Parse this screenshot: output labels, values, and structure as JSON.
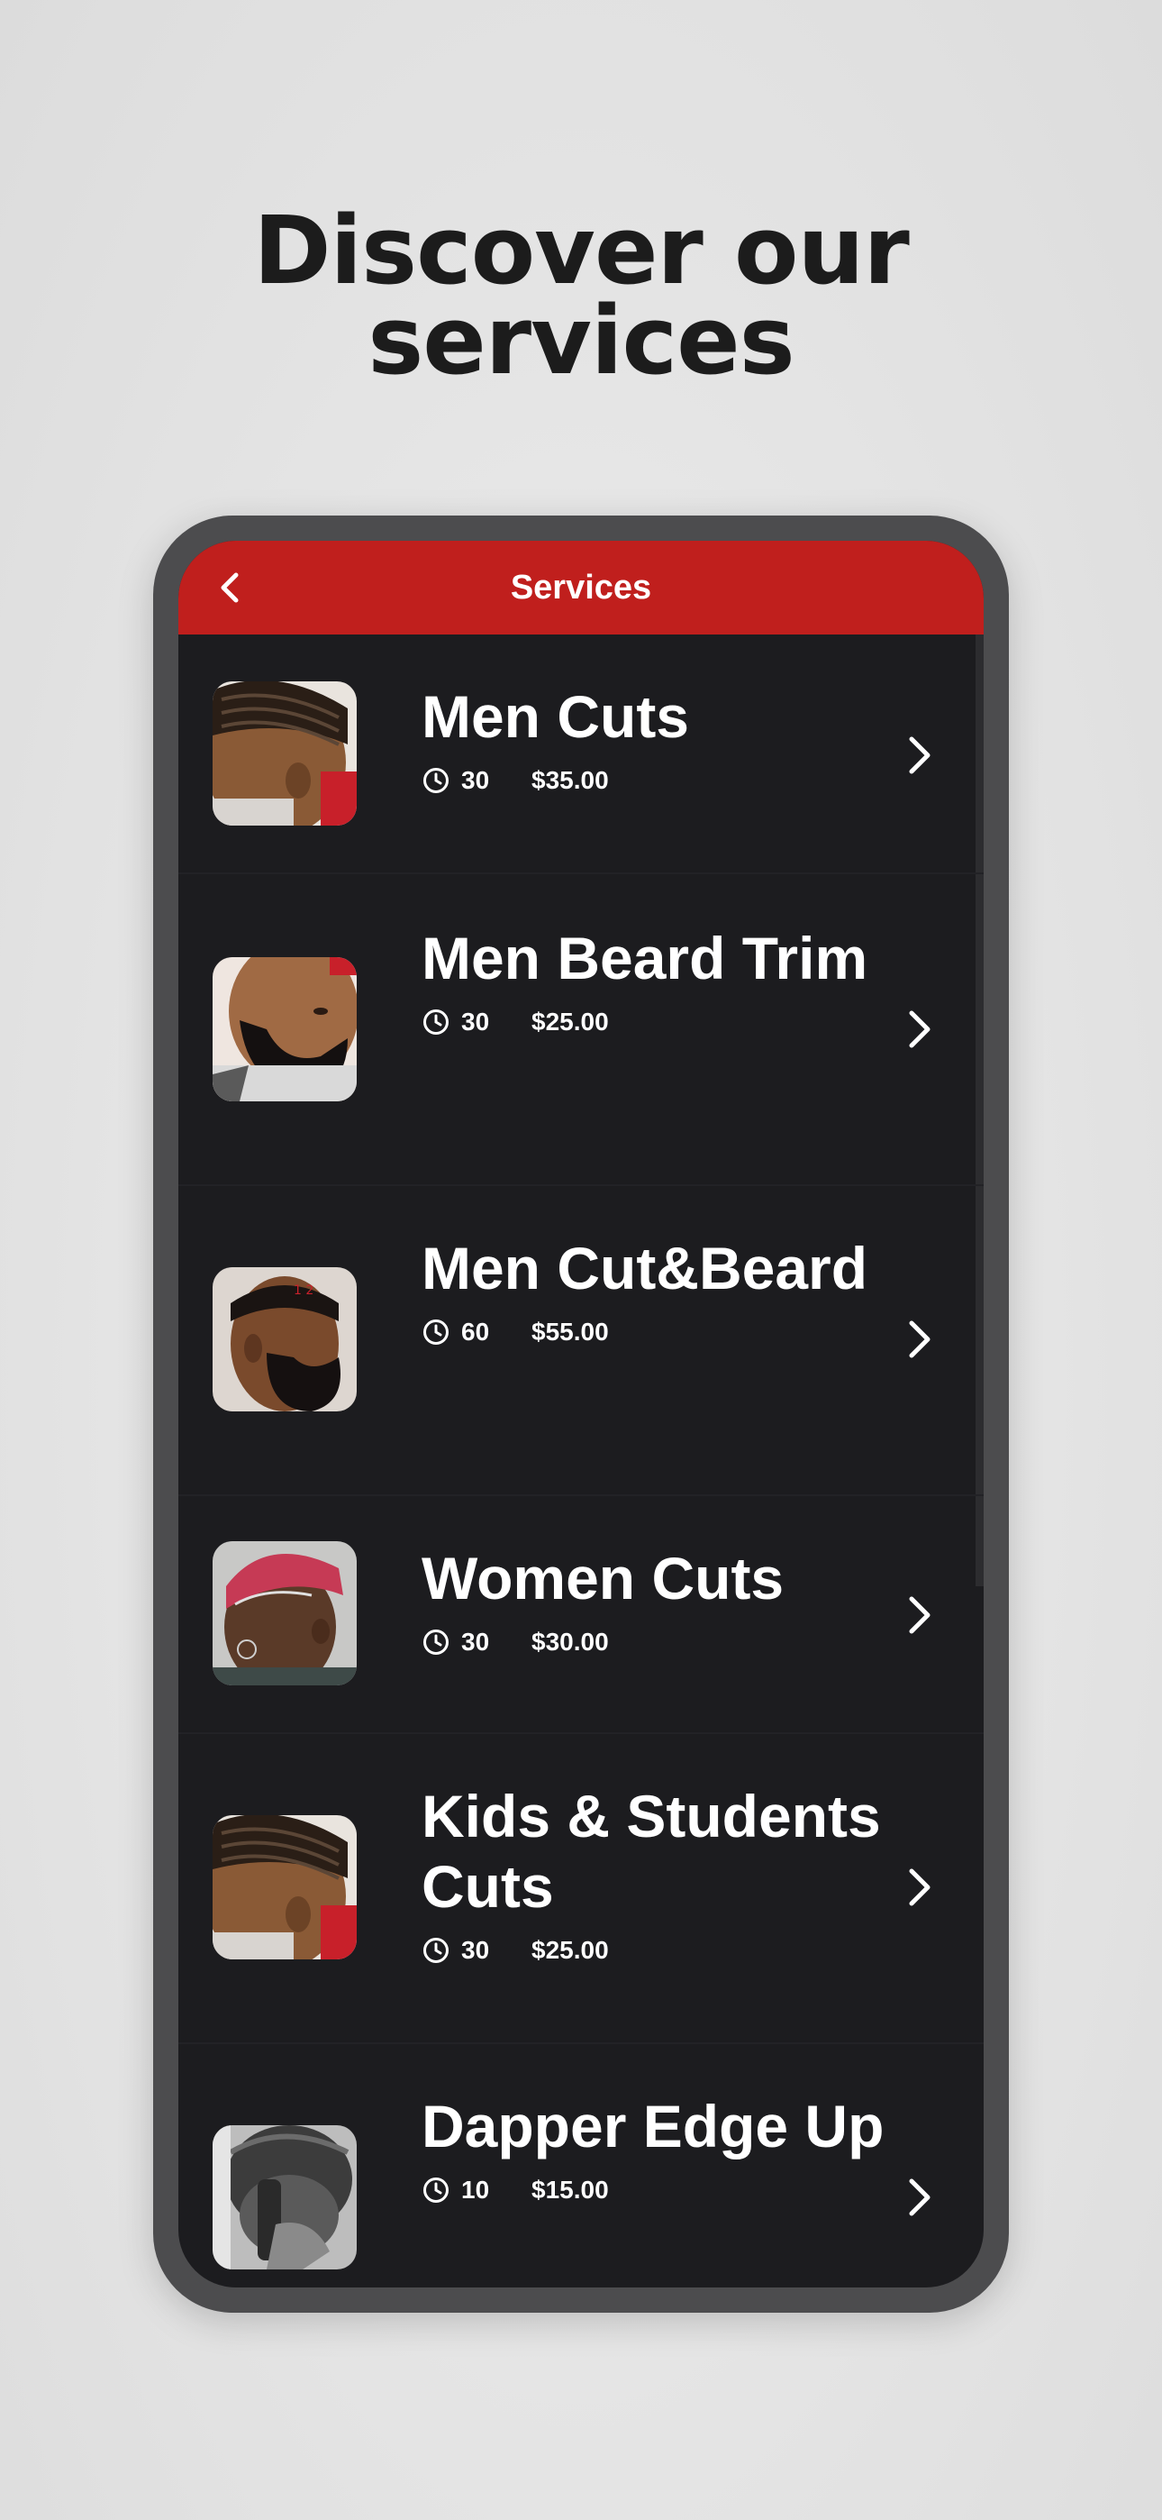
{
  "headline": {
    "line1": "Discover our",
    "line2": "services"
  },
  "header": {
    "title": "Services",
    "back_icon": "chevron-left-icon"
  },
  "colors": {
    "accent": "#c01f1d",
    "screen_bg": "#1c1c1f",
    "frame": "#4c4c4e"
  },
  "services": [
    {
      "name": "Men Cuts",
      "duration": "30",
      "price": "$35.00"
    },
    {
      "name": "Men Beard Trim",
      "duration": "30",
      "price": "$25.00"
    },
    {
      "name": "Men Cut&Beard",
      "duration": "60",
      "price": "$55.00"
    },
    {
      "name": "Women Cuts",
      "duration": "30",
      "price": "$30.00"
    },
    {
      "name": "Kids & Students Cuts",
      "duration": "30",
      "price": "$25.00"
    },
    {
      "name": "Dapper Edge Up",
      "duration": "10",
      "price": "$15.00"
    }
  ]
}
